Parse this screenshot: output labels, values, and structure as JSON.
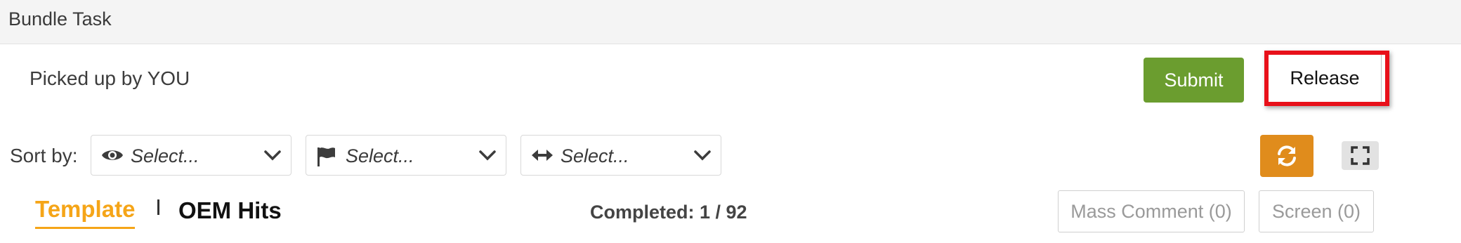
{
  "header": {
    "title": "Bundle Task"
  },
  "status": {
    "picked_up_text": "Picked up by YOU"
  },
  "actions": {
    "submit_label": "Submit",
    "release_label": "Release"
  },
  "sort": {
    "label": "Sort by:",
    "selects": [
      {
        "icon": "eye-icon",
        "value": "Select..."
      },
      {
        "icon": "flag-icon",
        "value": "Select..."
      },
      {
        "icon": "arrows-horizontal-icon",
        "value": "Select..."
      }
    ]
  },
  "tabs": [
    {
      "label": "Template",
      "active": true
    },
    {
      "label": "OEM Hits",
      "active": false
    }
  ],
  "progress": {
    "completed_text": "Completed: 1 / 92"
  },
  "buttons": {
    "mass_comment_label": "Mass Comment (0)",
    "screen_label": "Screen (0)"
  },
  "colors": {
    "submit": "#6b9d2f",
    "highlight": "#e8101a",
    "refresh": "#e08c1c",
    "active_tab": "#f5a518"
  }
}
